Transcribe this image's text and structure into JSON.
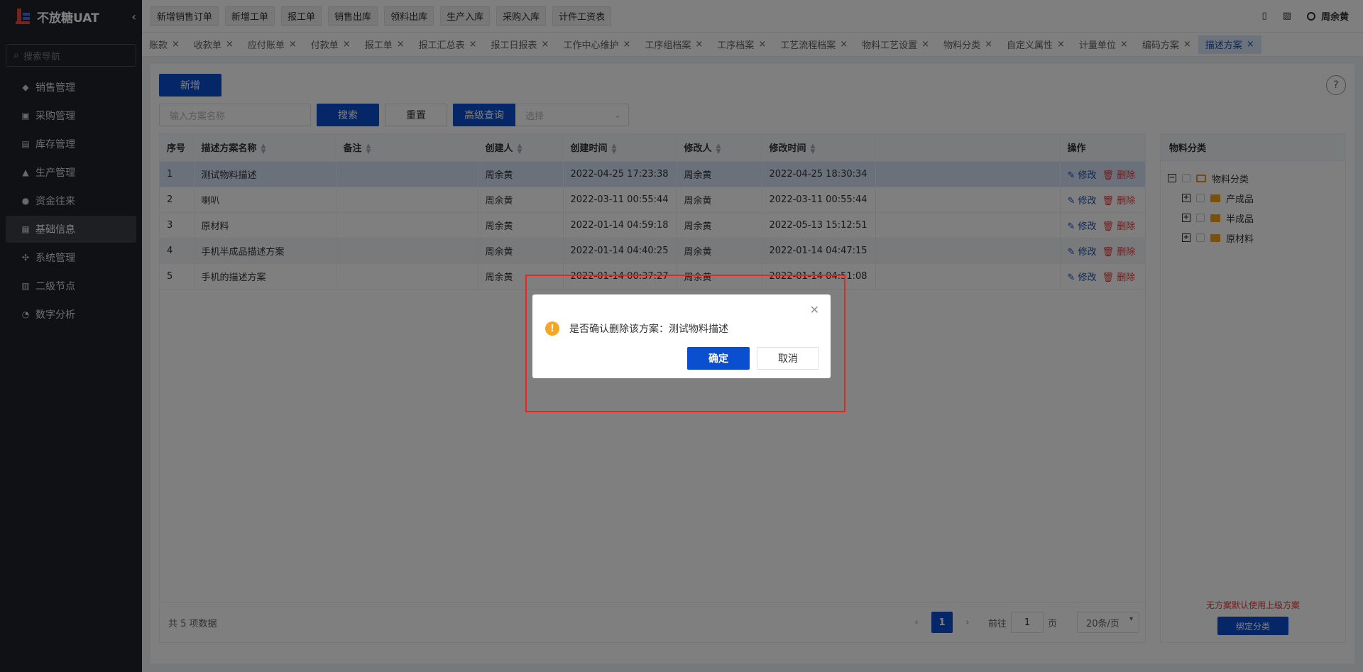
{
  "sidebar": {
    "brand": "不放糖UAT",
    "collapse_icon": "chevron-left-icon",
    "search_placeholder": "搜索导航",
    "items": [
      {
        "label": "销售管理",
        "icon": "tag-icon"
      },
      {
        "label": "采购管理",
        "icon": "cart-icon"
      },
      {
        "label": "库存管理",
        "icon": "box-icon"
      },
      {
        "label": "生产管理",
        "icon": "factory-icon"
      },
      {
        "label": "资金往来",
        "icon": "money-icon"
      },
      {
        "label": "基础信息",
        "icon": "grid-icon"
      },
      {
        "label": "系统管理",
        "icon": "apps-icon"
      },
      {
        "label": "二级节点",
        "icon": "doc-icon"
      },
      {
        "label": "数字分析",
        "icon": "pie-icon"
      }
    ]
  },
  "topbar": {
    "quick": [
      "新增销售订单",
      "新增工单",
      "报工单",
      "销售出库",
      "领料出库",
      "生产入库",
      "采购入库",
      "计件工资表"
    ],
    "user": "周余黄"
  },
  "tabs": [
    {
      "label": "账款"
    },
    {
      "label": "收款单"
    },
    {
      "label": "应付账单"
    },
    {
      "label": "付款单"
    },
    {
      "label": "报工单"
    },
    {
      "label": "报工汇总表"
    },
    {
      "label": "报工日报表"
    },
    {
      "label": "工作中心维护"
    },
    {
      "label": "工序组档案"
    },
    {
      "label": "工序档案"
    },
    {
      "label": "工艺流程档案"
    },
    {
      "label": "物料工艺设置"
    },
    {
      "label": "物料分类"
    },
    {
      "label": "自定义属性"
    },
    {
      "label": "计量单位"
    },
    {
      "label": "编码方案"
    },
    {
      "label": "描述方案"
    }
  ],
  "main": {
    "new_label": "新增",
    "search_placeholder": "输入方案名称",
    "search_label": "搜索",
    "reset_label": "重置",
    "advanced_label": "高级查询",
    "select_placeholder": "选择",
    "help": "?"
  },
  "table": {
    "headers": [
      "序号",
      "描述方案名称",
      "备注",
      "创建人",
      "创建时间",
      "修改人",
      "修改时间",
      "",
      "操作"
    ],
    "rows": [
      [
        "1",
        "测试物料描述",
        "",
        "周余黄",
        "2022-04-25 17:23:38",
        "周余黄",
        "2022-04-25 18:30:34"
      ],
      [
        "2",
        "喇叭",
        "",
        "周余黄",
        "2022-03-11 00:55:44",
        "周余黄",
        "2022-03-11 00:55:44"
      ],
      [
        "3",
        "原材料",
        "",
        "周余黄",
        "2022-01-14 04:59:18",
        "周余黄",
        "2022-05-13 15:12:51"
      ],
      [
        "4",
        "手机半成品描述方案",
        "",
        "周余黄",
        "2022-01-14 04:40:25",
        "周余黄",
        "2022-01-14 04:47:15"
      ],
      [
        "5",
        "手机的描述方案",
        "",
        "周余黄",
        "2022-01-14 00:37:27",
        "周余黄",
        "2022-01-14 04:51:08"
      ]
    ],
    "edit_label": "修改",
    "delete_label": "删除",
    "total": "共 5 项数据",
    "page": "1",
    "goto_prefix": "前往",
    "goto_value": "1",
    "goto_suffix": "页",
    "page_size": "20条/页"
  },
  "panel": {
    "title": "物料分类",
    "root": "物料分类",
    "children": [
      "产成品",
      "半成品",
      "原材料"
    ],
    "note": "无方案默认使用上级方案",
    "bind_label": "绑定分类"
  },
  "dialog": {
    "message": "是否确认删除该方案：测试物料描述",
    "ok_label": "确定",
    "cancel_label": "取消",
    "close_icon": "close-icon",
    "warn_icon": "warning-icon",
    "warn_glyph": "!"
  },
  "colors": {
    "primary": "#0b4fd1",
    "danger": "#e03a3a",
    "sidebar_bg": "#1f2329",
    "highlight_box": "#e8241f"
  }
}
